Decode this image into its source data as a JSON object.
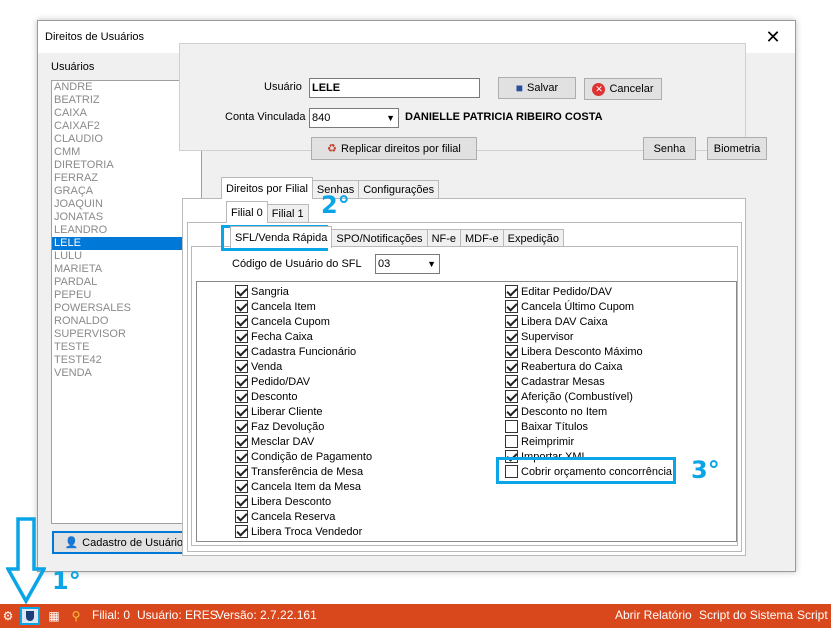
{
  "window": {
    "title": "Direitos de Usuários",
    "close_glyph": "✕"
  },
  "users": {
    "label": "Usuários",
    "items": [
      "ANDRE",
      "BEATRIZ",
      "CAIXA",
      "CAIXAF2",
      "CLAUDIO",
      "CMM",
      "DIRETORIA",
      "FERRAZ",
      "GRAÇA",
      "JOAQUIN",
      "JONATAS",
      "LEANDRO",
      "LELE",
      "LULU",
      "MARIETA",
      "PARDAL",
      "PEPEU",
      "POWERSALES",
      "RONALDO",
      "SUPERVISOR",
      "TESTE",
      "TESTE42",
      "VENDA"
    ],
    "selected": "LELE",
    "cadastro_button": "Cadastro de Usuários"
  },
  "form": {
    "usuario_label": "Usuário",
    "usuario_value": "LELE",
    "conta_label": "Conta Vinculada",
    "conta_value": "840",
    "conta_name": "DANIELLE PATRICIA RIBEIRO COSTA",
    "salvar": "Salvar",
    "cancelar": "Cancelar",
    "replicar": "Replicar direitos por filial",
    "senha": "Senha",
    "biometria": "Biometria"
  },
  "tabs_main": [
    "Direitos por Filial",
    "Senhas",
    "Configurações"
  ],
  "tabs_filial": [
    "Filial 0",
    "Filial 1"
  ],
  "tabs_section": [
    "SFL/Venda Rápida",
    "SPO/Notificações",
    "NF-e",
    "MDF-e",
    "Expedição"
  ],
  "codigo": {
    "label": "Código de Usuário do SFL",
    "value": "03"
  },
  "rights_left": [
    {
      "label": "Sangria",
      "checked": true
    },
    {
      "label": "Cancela Item",
      "checked": true
    },
    {
      "label": "Cancela Cupom",
      "checked": true
    },
    {
      "label": "Fecha Caixa",
      "checked": true
    },
    {
      "label": "Cadastra Funcionário",
      "checked": true
    },
    {
      "label": "Venda",
      "checked": true
    },
    {
      "label": "Pedido/DAV",
      "checked": true
    },
    {
      "label": "Desconto",
      "checked": true
    },
    {
      "label": "Liberar Cliente",
      "checked": true
    },
    {
      "label": "Faz Devolução",
      "checked": true
    },
    {
      "label": "Mesclar DAV",
      "checked": true
    },
    {
      "label": "Condição de Pagamento",
      "checked": true
    },
    {
      "label": "Transferência de Mesa",
      "checked": true
    },
    {
      "label": "Cancela Item da Mesa",
      "checked": true
    },
    {
      "label": "Libera Desconto",
      "checked": true
    },
    {
      "label": "Cancela Reserva",
      "checked": true
    },
    {
      "label": "Libera Troca Vendedor",
      "checked": true
    }
  ],
  "rights_right": [
    {
      "label": "Editar Pedido/DAV",
      "checked": true
    },
    {
      "label": "Cancela Último Cupom",
      "checked": true
    },
    {
      "label": "Libera DAV Caixa",
      "checked": true
    },
    {
      "label": "Supervisor",
      "checked": true
    },
    {
      "label": "Libera Desconto Máximo",
      "checked": true
    },
    {
      "label": "Reabertura do Caixa",
      "checked": true
    },
    {
      "label": "Cadastrar Mesas",
      "checked": true
    },
    {
      "label": "Aferição (Combustível)",
      "checked": true
    },
    {
      "label": "Desconto no Item",
      "checked": true
    },
    {
      "label": "Baixar Títulos",
      "checked": false
    },
    {
      "label": "Reimprimir",
      "checked": false
    },
    {
      "label": "Importar XML",
      "checked": true
    },
    {
      "label": "Cobrir orçamento concorrência",
      "checked": false
    }
  ],
  "annotations": {
    "one": "1°",
    "two": "2°",
    "three": "3°"
  },
  "statusbar": {
    "filial": "Filial: 0",
    "usuario": "Usuário: ERES",
    "versao": "Versão: 2.7.22.161",
    "abrir_relatorio": "Abrir Relatório",
    "script_sistema": "Script do Sistema",
    "script_cut": "Script"
  },
  "colors": {
    "accent": "#0078d7",
    "annotation": "#0aa5e6",
    "taskbar": "#d9481d"
  }
}
